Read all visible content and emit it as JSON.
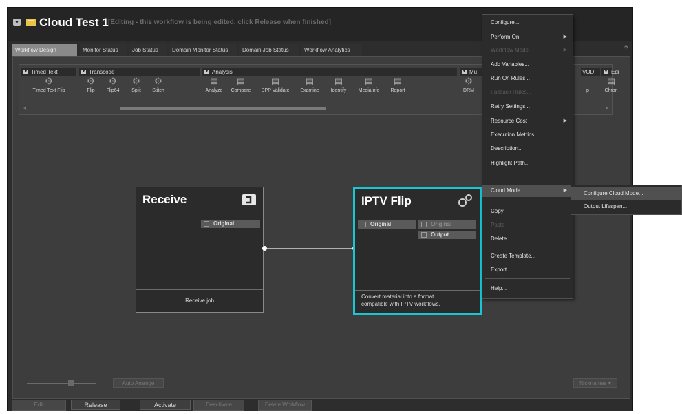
{
  "window": {
    "title": "Cloud Test 1",
    "status": "[Editing - this workflow is being edited, click Release when finished]",
    "help": "?"
  },
  "tabs": [
    {
      "label": "Workflow Design"
    },
    {
      "label": "Monitor Status"
    },
    {
      "label": "Job Status"
    },
    {
      "label": "Domain Monitor Status"
    },
    {
      "label": "Domain Job Status"
    },
    {
      "label": "Workflow Analytics"
    }
  ],
  "toolbox": {
    "groups": [
      {
        "label": "Timed Text"
      },
      {
        "label": "Transcode"
      },
      {
        "label": "Analysis"
      },
      {
        "label": "Mu"
      },
      {
        "label": "VOD"
      },
      {
        "label": "Edi"
      }
    ],
    "tools": [
      {
        "label": "Timed Text Flip",
        "icon": "timed-text-flip-icon"
      },
      {
        "label": "Flip",
        "icon": "gear-icon"
      },
      {
        "label": "Flip64",
        "icon": "gears-icon"
      },
      {
        "label": "Split",
        "icon": "split-icon"
      },
      {
        "label": "Stitch",
        "icon": "stitch-icon"
      },
      {
        "label": "Analyze",
        "icon": "analyze-icon"
      },
      {
        "label": "Compare",
        "icon": "compare-icon"
      },
      {
        "label": "DPP Validate",
        "icon": "validate-icon"
      },
      {
        "label": "Examine",
        "icon": "examine-icon"
      },
      {
        "label": "Identify",
        "icon": "identify-icon"
      },
      {
        "label": "MediaInfo",
        "icon": "mediainfo-icon"
      },
      {
        "label": "Report",
        "icon": "report-icon"
      },
      {
        "label": "DRM",
        "icon": "drm-icon"
      },
      {
        "label": "p",
        "icon": "package-icon"
      },
      {
        "label": "Chron",
        "icon": "chronicle-icon"
      }
    ]
  },
  "nodes": {
    "receive": {
      "title": "Receive",
      "output_port": "Original",
      "footer": "Receive job"
    },
    "iptv": {
      "title": "IPTV Flip",
      "input_port": "Original",
      "output_original": "Original",
      "output_output": "Output",
      "footer_line1": "Convert material into a format",
      "footer_line2": "compatible with IPTV workflows."
    }
  },
  "bottom": {
    "auto_arrange": "Auto Arrange",
    "nicknames": "Nicknames",
    "edit": "Edit",
    "release": "Release",
    "activate": "Activate",
    "deactivate": "Deactivate",
    "delete_workflow": "Delete Workflow"
  },
  "context_menu": {
    "items": [
      {
        "label": "Configure...",
        "has_submenu": false,
        "disabled": false
      },
      {
        "label": "Perform On",
        "has_submenu": true,
        "disabled": false
      },
      {
        "label": "Workflow Mode",
        "has_submenu": true,
        "disabled": true
      },
      {
        "label": "Add Variables...",
        "has_submenu": false,
        "disabled": false
      },
      {
        "label": "Run On Rules...",
        "has_submenu": false,
        "disabled": false
      },
      {
        "label": "Fallback Rules...",
        "has_submenu": false,
        "disabled": true
      },
      {
        "label": "Retry Settings...",
        "has_submenu": false,
        "disabled": false
      },
      {
        "label": "Resource Cost",
        "has_submenu": true,
        "disabled": false
      },
      {
        "label": "Execution Metrics...",
        "has_submenu": false,
        "disabled": false
      },
      {
        "label": "Description...",
        "has_submenu": false,
        "disabled": false
      },
      {
        "label": "Highlight Path...",
        "has_submenu": false,
        "disabled": false
      },
      {
        "label": "Cloud Mode",
        "has_submenu": true,
        "disabled": false
      },
      {
        "label": "Copy",
        "has_submenu": false,
        "disabled": false
      },
      {
        "label": "Paste",
        "has_submenu": false,
        "disabled": true
      },
      {
        "label": "Delete",
        "has_submenu": false,
        "disabled": false
      },
      {
        "label": "Create Template...",
        "has_submenu": false,
        "disabled": false
      },
      {
        "label": "Export...",
        "has_submenu": false,
        "disabled": false
      },
      {
        "label": "Help...",
        "has_submenu": false,
        "disabled": false
      }
    ]
  },
  "submenu": {
    "items": [
      {
        "label": "Configure Cloud Mode..."
      },
      {
        "label": "Output Lifespan..."
      }
    ]
  },
  "colors": {
    "selection_accent": "#19c6d6",
    "workflow_icon": "#e8c44a"
  }
}
